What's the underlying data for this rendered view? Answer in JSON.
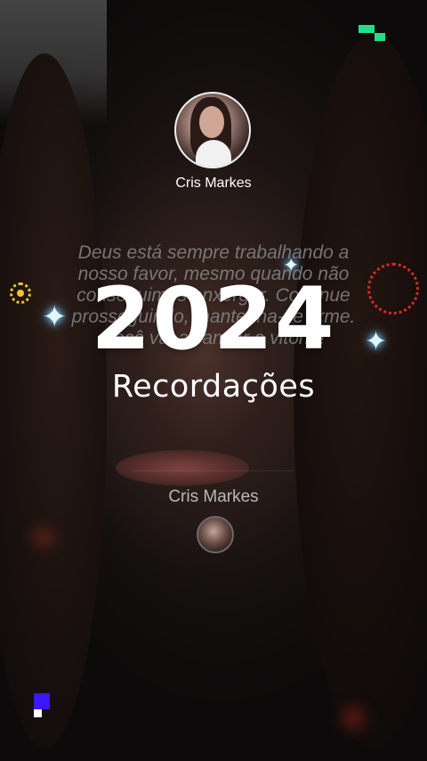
{
  "profile": {
    "name_top": "Cris Markes",
    "name_bottom": "Cris Markes"
  },
  "quote": "Deus está sempre trabalhando a nosso favor, mesmo quando não conseguimos enxergar. Continue prosseguindo, mantenha-se firme. Você vai alcançar a vitória!",
  "headline": {
    "year": "2024",
    "subtitle": "Recordações"
  },
  "decor": {
    "sparkle_icon": "✦",
    "colors": {
      "sparkle": "#dff6ff",
      "sun": "#f2c230",
      "ring": "#d8282a",
      "pixel_green": "#1ee08a",
      "pixel_blue": "#3b16ff"
    }
  }
}
